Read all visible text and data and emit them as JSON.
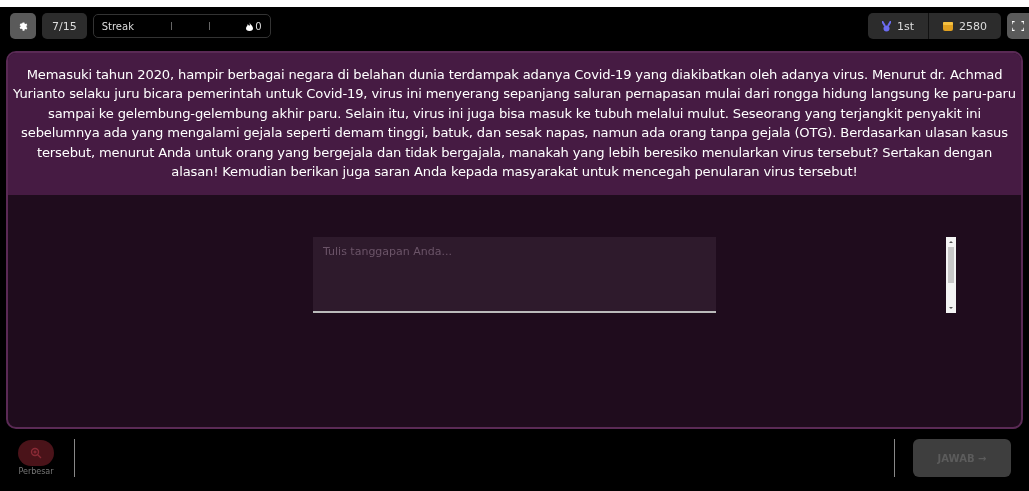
{
  "top_bar": {
    "progress": "7/15",
    "streak": {
      "label": "Streak",
      "count": "0"
    },
    "rank": "1st",
    "coins": "2580"
  },
  "question": {
    "text": "Memasuki tahun 2020, hampir berbagai negara di belahan dunia terdampak adanya Covid-19 yang diakibatkan oleh adanya virus. Menurut dr. Achmad Yurianto selaku juru bicara pemerintah untuk Covid-19, virus ini menyerang sepanjang saluran pernapasan mulai dari rongga hidung langsung ke paru-paru sampai ke gelembung-gelembung akhir paru. Selain itu, virus ini juga bisa masuk ke tubuh melalui mulut. Seseorang yang terjangkit penyakit ini sebelumnya ada yang mengalami gejala seperti demam tinggi, batuk, dan sesak napas, namun ada orang tanpa gejala (OTG). Berdasarkan ulasan kasus tersebut, menurut Anda untuk orang yang bergejala dan tidak bergajala, manakah yang lebih beresiko menularkan virus tersebut? Sertakan dengan alasan! Kemudian berikan juga saran Anda kepada masyarakat untuk mencegah penularan virus tersebut!"
  },
  "answer": {
    "placeholder": "Tulis tanggapan Anda..."
  },
  "bottom_bar": {
    "zoom_label": "Perbesar",
    "submit": {
      "label": "JAWAB →",
      "disabled": true
    }
  }
}
